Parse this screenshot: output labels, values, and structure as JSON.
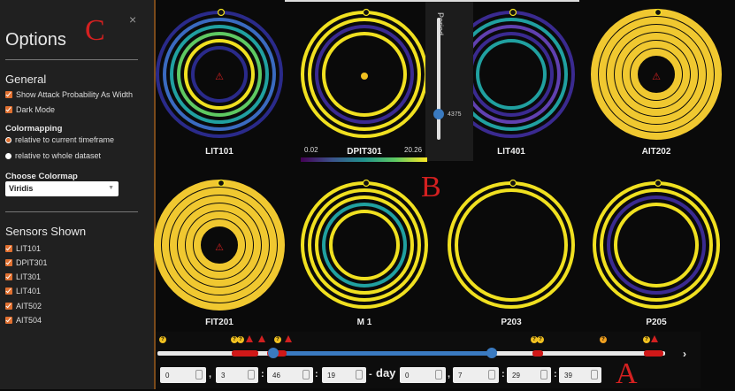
{
  "annotations": {
    "a": "A",
    "b": "B",
    "c": "C"
  },
  "options": {
    "title": "Options",
    "close_label": "×",
    "general_header": "General",
    "show_attack": "Show Attack Probability As Width",
    "dark_mode": "Dark Mode",
    "colormapping_header": "Colormapping",
    "relative_timeframe": "relative to current timeframe",
    "relative_dataset": "relative to whole dataset",
    "choose_colormap": "Choose Colormap",
    "colormap_value": "Viridis",
    "sensors_header": "Sensors Shown",
    "sensors": [
      "LIT101",
      "DPIT301",
      "LIT301",
      "LIT401",
      "AIT502",
      "AIT504"
    ]
  },
  "grid": {
    "sensors": [
      {
        "label": "LIT101",
        "palette": "mixed",
        "warn": true,
        "rings": 6
      },
      {
        "label": "DPIT301",
        "palette": "yellow-purple",
        "warn": false,
        "q": true,
        "rings": 4
      },
      {
        "label": "LIT401",
        "palette": "teal-purple",
        "warn": false,
        "rings": 5
      },
      {
        "label": "AIT202",
        "palette": "yellow",
        "warn": true,
        "rings": 6
      },
      {
        "label": "FIT201",
        "palette": "yellow",
        "warn": true,
        "rings": 6
      },
      {
        "label": "M  1",
        "palette": "yellow-teal",
        "warn": false,
        "rings": 5
      },
      {
        "label": "P203",
        "palette": "yellow-purple",
        "warn": false,
        "rings": 2
      },
      {
        "label": "P205",
        "palette": "yellow-purple",
        "warn": false,
        "rings": 4
      }
    ]
  },
  "period": {
    "label": "Period",
    "value": "4375",
    "fraction": 0.78
  },
  "colorbar": {
    "min": "0.02",
    "max": "20.26"
  },
  "timeline": {
    "start": [
      "0",
      "3",
      "46",
      "19"
    ],
    "end": [
      "0",
      "7",
      "29",
      "39"
    ],
    "day_label": "day",
    "separators": [
      ",",
      ":",
      ":"
    ],
    "next_label": "›"
  },
  "colors": {
    "accent": "#e07030",
    "yellow": "#f0e020",
    "purple": "#3a2a90",
    "teal": "#20a0a0",
    "slider_blue": "#3a7ac0"
  }
}
